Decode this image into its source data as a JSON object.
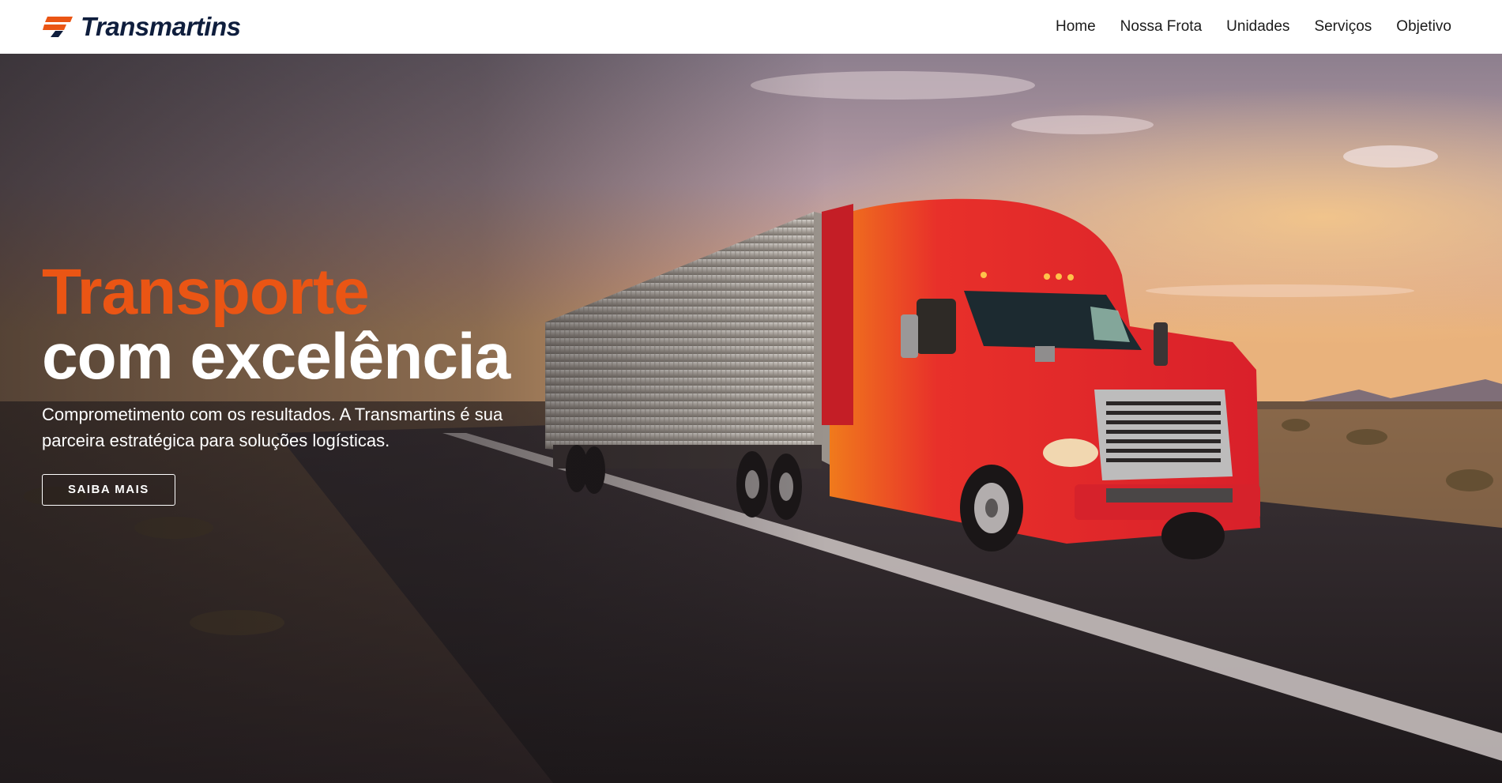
{
  "brand": {
    "name": "Transmartins",
    "accent_color": "#ea5514",
    "text_color": "#0f1e3d",
    "logo_icon": "stylized-t-logo-icon"
  },
  "nav": {
    "items": [
      {
        "label": "Home"
      },
      {
        "label": "Nossa Frota"
      },
      {
        "label": "Unidades"
      },
      {
        "label": "Serviços"
      },
      {
        "label": "Objetivo"
      }
    ]
  },
  "hero": {
    "title_accent": "Transporte",
    "title_main": "com excelência",
    "subtitle": "Comprometimento com os resultados. A Transmartins é sua parceira estratégica para soluções logísticas.",
    "cta_label": "SAIBA MAIS",
    "background": "red-semi-truck-on-highway-at-sunset"
  }
}
